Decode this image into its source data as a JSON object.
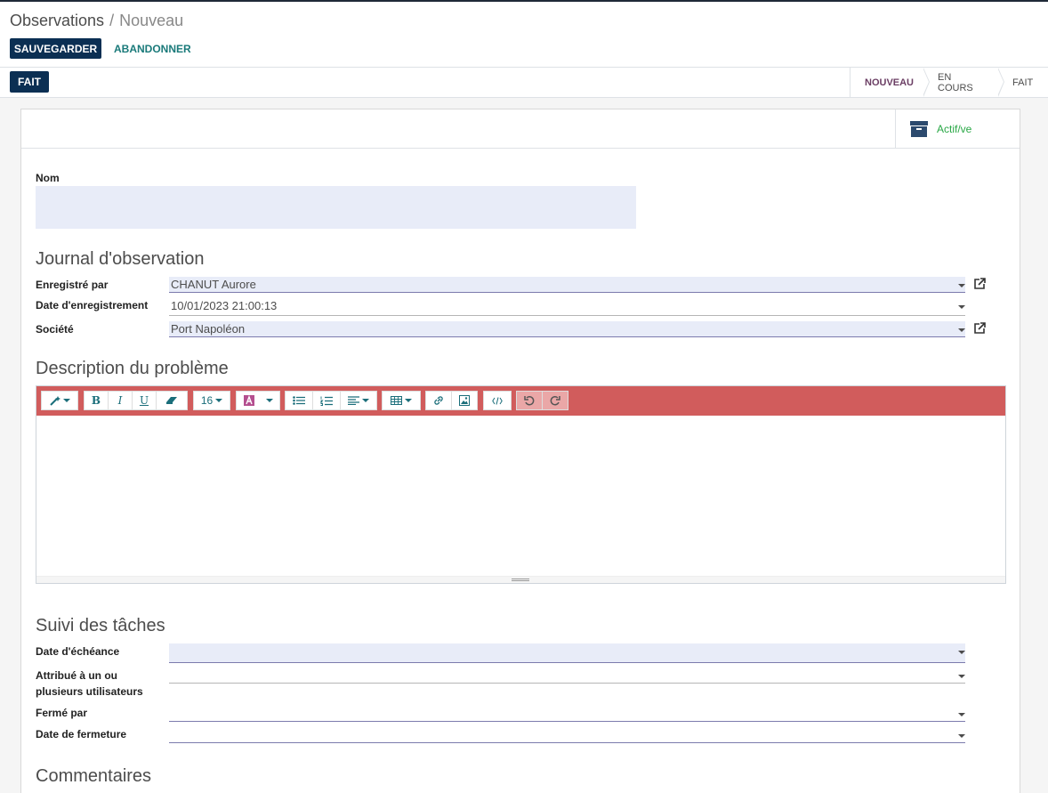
{
  "breadcrumb": {
    "parent": "Observations",
    "separator": "/",
    "current": "Nouveau"
  },
  "actions": {
    "save": "SAUVEGARDER",
    "discard": "ABANDONNER"
  },
  "statusbar": {
    "done_button": "FAIT",
    "steps": [
      {
        "label": "NOUVEAU",
        "active": true
      },
      {
        "label": "EN COURS",
        "active": false
      },
      {
        "label": "FAIT",
        "active": false
      }
    ]
  },
  "button_box": {
    "archive_label": "Actif/ve",
    "archive_icon": "archive-box-icon"
  },
  "form": {
    "name_label": "Nom",
    "name_value": "",
    "journal": {
      "title": "Journal d'observation",
      "recorded_by_label": "Enregistré par",
      "recorded_by_value": "CHANUT Aurore",
      "recorded_date_label": "Date d'enregistrement",
      "recorded_date_value": "10/01/2023 21:00:13",
      "company_label": "Société",
      "company_value": "Port Napoléon"
    },
    "description": {
      "title": "Description du problème",
      "font_size": "16",
      "toolbar_icons": [
        "magic-wand-icon",
        "bold-icon",
        "italic-icon",
        "underline-icon",
        "eraser-icon",
        "font-size-dropdown",
        "font-color-icon",
        "bullet-list-icon",
        "numbered-list-icon",
        "align-icon",
        "table-icon",
        "link-icon",
        "image-icon",
        "code-view-icon",
        "undo-icon",
        "redo-icon"
      ]
    },
    "tasks": {
      "title": "Suivi des tâches",
      "due_date_label": "Date d'échéance",
      "due_date_value": "",
      "assigned_label_1": "Attribué à un ou",
      "assigned_label_2": "plusieurs utilisateurs",
      "assigned_value": "",
      "closed_by_label": "Fermé par",
      "closed_by_value": "",
      "closed_date_label": "Date de fermeture",
      "closed_date_value": ""
    },
    "comments_title": "Commentaires"
  },
  "colors": {
    "primary": "#0b2f53",
    "link": "#1a7a7a",
    "toolbar_bg": "#d15c5c",
    "field_fill": "#e8ecf8",
    "active_step": "#6b3e64",
    "archive_green": "#28a745"
  }
}
